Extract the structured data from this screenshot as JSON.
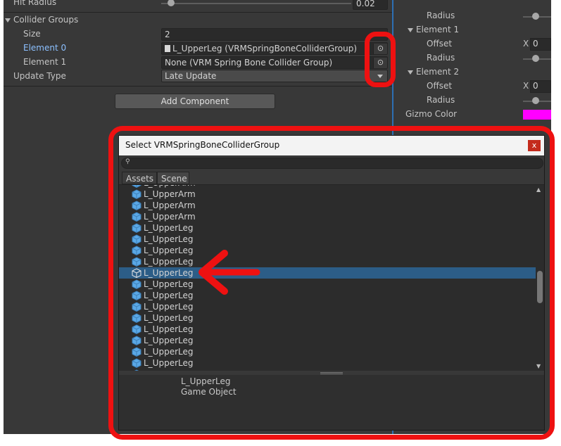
{
  "inspector": {
    "hit_radius_label": "Hit Radius",
    "hit_radius_value": "0.02",
    "collider_groups_label": "Collider Groups",
    "size_label": "Size",
    "size_value": "2",
    "element0_label": "Element 0",
    "element0_value": "L_UpperLeg (VRMSpringBoneColliderGroup)",
    "element1_label": "Element 1",
    "element1_value": "None (VRM Spring Bone Collider Group)",
    "update_type_label": "Update Type",
    "update_type_value": "Late Update",
    "add_component_label": "Add Component"
  },
  "right_panel": {
    "radius_label": "Radius",
    "element1_label": "Element 1",
    "offset_label": "Offset",
    "element2_label": "Element 2",
    "x_label": "X",
    "x_value": "0",
    "gizmo_color_label": "Gizmo Color",
    "gizmo_color": "#ff00ff"
  },
  "dialog": {
    "title": "Select VRMSpringBoneColliderGroup",
    "close_label": "x",
    "search_placeholder": "",
    "tabs": [
      "Assets",
      "Scene"
    ],
    "items": [
      "L_UpperArm",
      "L_UpperArm",
      "L_UpperArm",
      "L_UpperArm",
      "L_UpperLeg",
      "L_UpperLeg",
      "L_UpperLeg",
      "L_UpperLeg",
      "L_UpperLeg",
      "L_UpperLeg",
      "L_UpperLeg",
      "L_UpperLeg",
      "L_UpperLeg",
      "L_UpperLeg",
      "L_UpperLeg",
      "L_UpperLeg",
      "L_UpperLeg",
      "L_UpperLeg"
    ],
    "selected_index": 8,
    "preview_name": "L_UpperLeg",
    "preview_type": "Game Object"
  },
  "colors": {
    "annotation_red": "#ee1111",
    "selection_blue": "#2c5d87",
    "cube_blue": "#5aa8e6",
    "link_blue": "#8cc0ff"
  }
}
